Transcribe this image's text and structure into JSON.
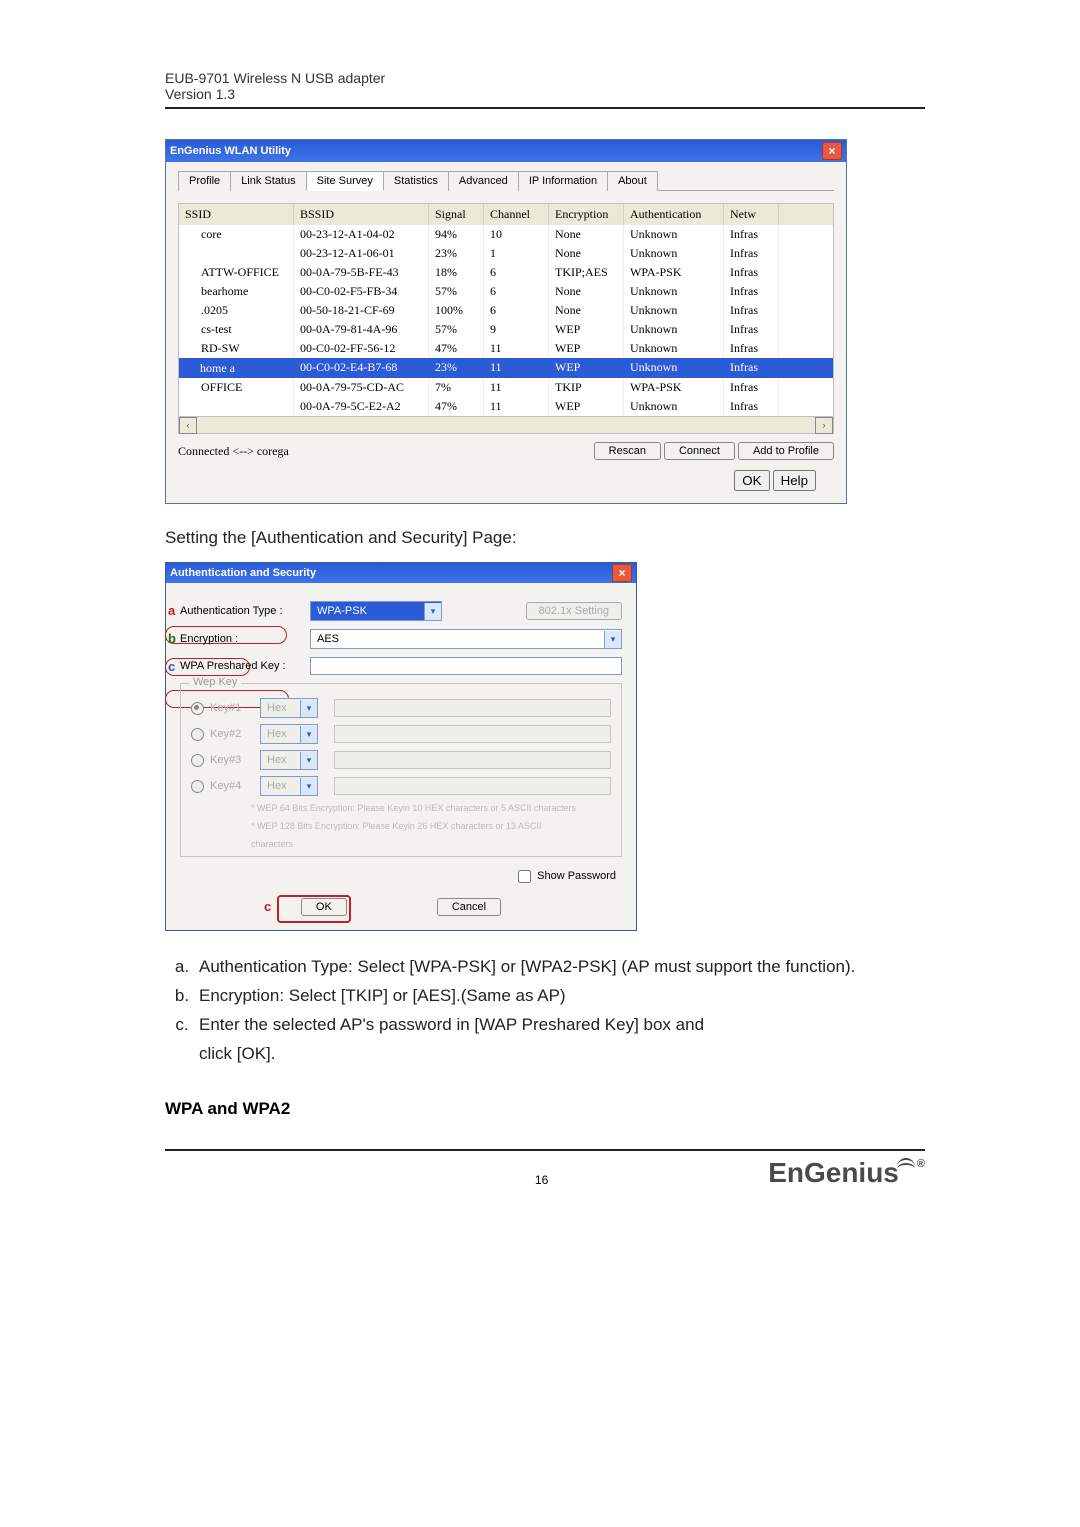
{
  "header": {
    "line1": "EUB-9701 Wireless N USB adapter",
    "line2": "Version 1.3"
  },
  "wlan_window": {
    "title": "EnGenius WLAN Utility",
    "tabs": [
      "Profile",
      "Link Status",
      "Site Survey",
      "Statistics",
      "Advanced",
      "IP Information",
      "About"
    ],
    "active_tab": "Site Survey",
    "columns": [
      "SSID",
      "BSSID",
      "Signal",
      "Channel",
      "Encryption",
      "Authentication",
      "Netw"
    ],
    "rows": [
      {
        "ssid": "core",
        "bssid": "00-23-12-A1-04-02",
        "signal": "94%",
        "channel": "10",
        "enc": "None",
        "auth": "Unknown",
        "net": "Infras"
      },
      {
        "ssid": "",
        "bssid": "00-23-12-A1-06-01",
        "signal": "23%",
        "channel": "1",
        "enc": "None",
        "auth": "Unknown",
        "net": "Infras"
      },
      {
        "ssid": "ATTW-OFFICE",
        "bssid": "00-0A-79-5B-FE-43",
        "signal": "18%",
        "channel": "6",
        "enc": "TKIP;AES",
        "auth": "WPA-PSK",
        "net": "Infras"
      },
      {
        "ssid": "bearhome",
        "bssid": "00-C0-02-F5-FB-34",
        "signal": "57%",
        "channel": "6",
        "enc": "None",
        "auth": "Unknown",
        "net": "Infras"
      },
      {
        "ssid": ".0205",
        "bssid": "00-50-18-21-CF-69",
        "signal": "100%",
        "channel": "6",
        "enc": "None",
        "auth": "Unknown",
        "net": "Infras"
      },
      {
        "ssid": "cs-test",
        "bssid": "00-0A-79-81-4A-96",
        "signal": "57%",
        "channel": "9",
        "enc": "WEP",
        "auth": "Unknown",
        "net": "Infras"
      },
      {
        "ssid": "RD-SW",
        "bssid": "00-C0-02-FF-56-12",
        "signal": "47%",
        "channel": "11",
        "enc": "WEP",
        "auth": "Unknown",
        "net": "Infras"
      },
      {
        "ssid": "home a",
        "bssid": "00-C0-02-E4-B7-68",
        "signal": "23%",
        "channel": "11",
        "enc": "WEP",
        "auth": "Unknown",
        "net": "Infras",
        "selected": true
      },
      {
        "ssid": "OFFICE",
        "bssid": "00-0A-79-75-CD-AC",
        "signal": "7%",
        "channel": "11",
        "enc": "TKIP",
        "auth": "WPA-PSK",
        "net": "Infras"
      },
      {
        "ssid": "",
        "bssid": "00-0A-79-5C-E2-A2",
        "signal": "47%",
        "channel": "11",
        "enc": "WEP",
        "auth": "Unknown",
        "net": "Infras"
      }
    ],
    "status": "Connected <--> corega",
    "buttons": {
      "rescan": "Rescan",
      "connect": "Connect",
      "add": "Add to Profile",
      "ok": "OK",
      "help": "Help"
    }
  },
  "caption_between": "Setting the [Authentication and Security] Page:",
  "auth_dialog": {
    "title": "Authentication and Security",
    "auth_type_label": "Authentication Type :",
    "auth_type_value": "WPA-PSK",
    "btn_8021x": "802.1x Setting",
    "encryption_label": "Encryption :",
    "encryption_value": "AES",
    "wpa_key_label": "WPA Preshared Key :",
    "wep_legend": "Wep Key",
    "wep_keys": [
      {
        "label": "Key#1",
        "fmt": "Hex",
        "on": true
      },
      {
        "label": "Key#2",
        "fmt": "Hex",
        "on": false
      },
      {
        "label": "Key#3",
        "fmt": "Hex",
        "on": false
      },
      {
        "label": "Key#4",
        "fmt": "Hex",
        "on": false
      }
    ],
    "wep_note1": "* WEP 64 Bits Encryption:  Please Keyin 10 HEX characters or 5 ASCII characters",
    "wep_note2": "* WEP 128 Bits Encryption:  Please Keyin 26 HEX characters or 13 ASCII",
    "wep_note3": "characters",
    "show_password": "Show Password",
    "ok": "OK",
    "cancel": "Cancel"
  },
  "explain": {
    "a": "Authentication Type: Select [WPA-PSK] or [WPA2-PSK] (AP must support the function).",
    "b": "Encryption: Select [TKIP] or [AES].(Same as AP)",
    "c1": "Enter the selected AP's password in [WAP Preshared Key] box and",
    "c2": "click [OK]."
  },
  "section_heading": "WPA and WPA2",
  "footer": {
    "page": "16",
    "logo": "EnGenius"
  }
}
